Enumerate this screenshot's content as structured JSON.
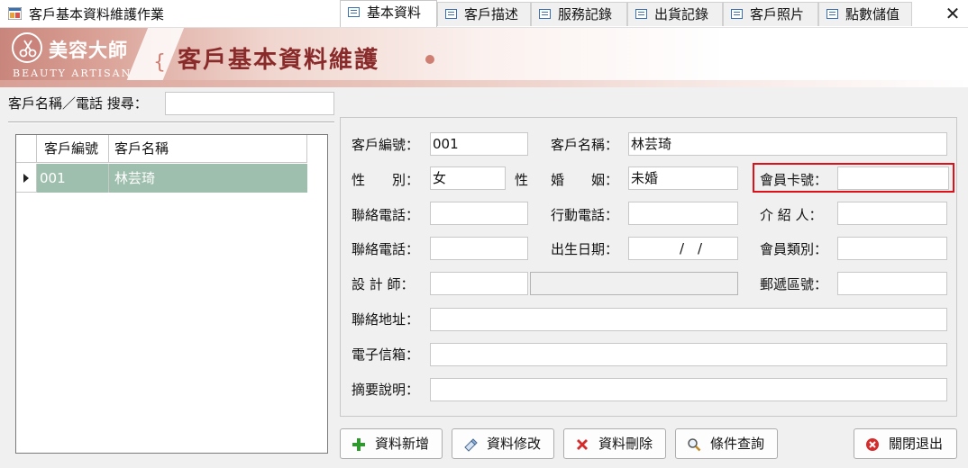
{
  "window": {
    "title": "客戶基本資料維護作業",
    "close_glyph": "✕"
  },
  "banner": {
    "logo_cn": "美容大師",
    "logo_en": "BEAUTY ARTISAN",
    "title": "客戶基本資料維護"
  },
  "search": {
    "label": "客戶名稱／電話 搜尋：",
    "value": ""
  },
  "grid": {
    "columns": [
      "客戶編號",
      "客戶名稱"
    ],
    "rows": [
      {
        "id": "001",
        "name": "林芸琦"
      }
    ]
  },
  "tabs": [
    {
      "label": "基本資料",
      "active": true
    },
    {
      "label": "客戶描述",
      "active": false
    },
    {
      "label": "服務記錄",
      "active": false
    },
    {
      "label": "出貨記錄",
      "active": false
    },
    {
      "label": "客戶照片",
      "active": false
    },
    {
      "label": "點數儲值",
      "active": false
    }
  ],
  "form": {
    "customer_no": {
      "label": "客戶編號：",
      "value": "001"
    },
    "customer_name": {
      "label": "客戶名稱：",
      "value": "林芸琦"
    },
    "gender": {
      "label": "性　　別：",
      "value": "女",
      "suffix": "性"
    },
    "marital": {
      "label": "婚　　姻：",
      "value": "未婚"
    },
    "member_card": {
      "label": "會員卡號：",
      "value": ""
    },
    "phone1": {
      "label": "聯絡電話：",
      "value": ""
    },
    "mobile": {
      "label": "行動電話：",
      "value": ""
    },
    "referrer": {
      "label": "介 紹 人：",
      "value": ""
    },
    "phone2": {
      "label": "聯絡電話：",
      "value": ""
    },
    "birthday": {
      "label": "出生日期：",
      "value": "　/　/"
    },
    "member_type": {
      "label": "會員類別：",
      "value": ""
    },
    "designer": {
      "label": "設 計 師：",
      "value": "",
      "name_value": ""
    },
    "zip": {
      "label": "郵遞區號：",
      "value": ""
    },
    "address": {
      "label": "聯絡地址：",
      "value": ""
    },
    "email": {
      "label": "電子信箱：",
      "value": ""
    },
    "summary": {
      "label": "摘要說明：",
      "value": ""
    }
  },
  "buttons": {
    "add": "資料新增",
    "edit": "資料修改",
    "delete": "資料刪除",
    "query": "條件查詢",
    "exit": "關閉退出"
  },
  "colors": {
    "selected_row": "#9fbfae",
    "highlight": "#e0101a",
    "banner_title": "#8a2b2b"
  }
}
